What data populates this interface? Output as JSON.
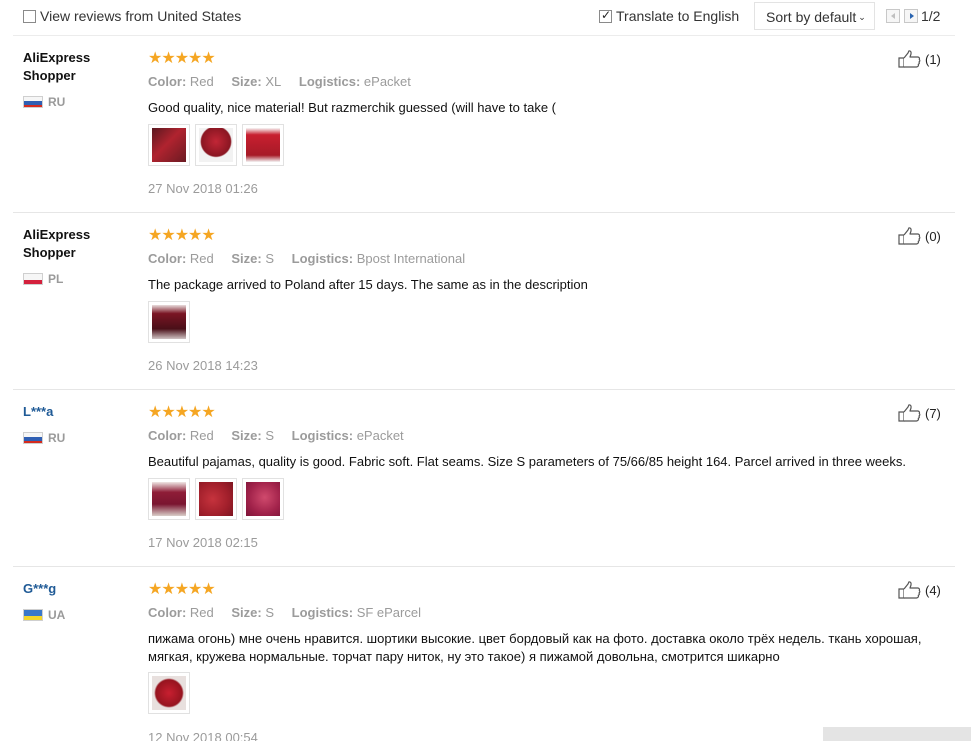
{
  "filters": {
    "view_reviews_label": "View reviews from United States",
    "view_reviews_checked": false,
    "translate_label": "Translate to English",
    "translate_checked": true,
    "sort_label": "Sort by default",
    "page_indicator": "1/2"
  },
  "labels": {
    "color": "Color:",
    "size": "Size:",
    "logistics": "Logistics:"
  },
  "colors": {
    "star": "#f5a623",
    "username_link": "#1f5a96",
    "muted": "#9b9b9b"
  },
  "reviews": [
    {
      "user": "AliExpress Shopper",
      "country": "RU",
      "stars": "★★★★★",
      "color": "Red",
      "size": "XL",
      "logistics": "ePacket",
      "text": "Good quality, nice material! But razmerchik guessed (will have to take (",
      "photos": 3,
      "date": "27 Nov 2018 01:26",
      "likes": "(1)"
    },
    {
      "user": "AliExpress Shopper",
      "country": "PL",
      "stars": "★★★★★",
      "color": "Red",
      "size": "S",
      "logistics": "Bpost International",
      "text": "The package arrived to Poland after 15 days. The same as in the description",
      "photos": 1,
      "date": "26 Nov 2018 14:23",
      "likes": "(0)"
    },
    {
      "user": "L***a",
      "country": "RU",
      "stars": "★★★★★",
      "color": "Red",
      "size": "S",
      "logistics": "ePacket",
      "text": "Beautiful pajamas, quality is good. Fabric soft. Flat seams. Size S parameters of 75/66/85 height 164. Parcel arrived in three weeks.",
      "photos": 3,
      "date": "17 Nov 2018 02:15",
      "likes": "(7)"
    },
    {
      "user": "G***g",
      "country": "UA",
      "stars": "★★★★★",
      "color": "Red",
      "size": "S",
      "logistics": "SF eParcel",
      "text": "пижама огонь) мне очень нравится. шортики высокие. цвет бордовый как на фото. доставка около трёх недель. ткань хорошая, мягкая, кружева нормальные. торчат пару ниток, ну это такое) я пижамой довольна, смотрится шикарно",
      "photos": 1,
      "date": "12 Nov 2018 00:54",
      "likes": "(4)"
    }
  ]
}
